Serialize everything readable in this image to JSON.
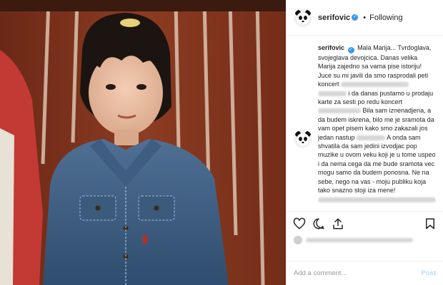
{
  "post": {
    "username": "serifovic",
    "follow_status": "Following",
    "separator": "•",
    "verified_glyph": "✓",
    "icons": {
      "avatar": "panda-avatar-icon",
      "verified": "verified-badge-icon",
      "like": "heart-icon",
      "comment": "comment-bubble-icon",
      "share": "share-upload-icon",
      "save": "bookmark-icon"
    },
    "photo_description_name": "child-in-denim-jacket-photo"
  },
  "caption": {
    "username": "serifovic",
    "parts": [
      "Mala Marija... Tvrdoglava, svojeglava devojcica. Danas velika Marija zajedno sa vama pise istoriju! Juce su mi javili da smo rasprodali peti koncert",
      "i da danas pustamo u prodaju karte za sesti po redu koncert",
      "Bila sam iznenadjena, a da budem iskrena, bilo me je sramota da vam opet pisem kako smo zakazali jos jedan nastup",
      "A onda sam shvatila da sam jedini izvodjac pop muzike u ovom veku koji je u tome uspeo i da nema cega da me bude sramota vec mogu samo da budem ponosna. Ne na sebe, nego na vas - moju publiku koja tako snazno stoji iza mene!"
    ]
  },
  "comment_box": {
    "placeholder": "Add a comment...",
    "post_label": "Post"
  },
  "colors": {
    "accent": "#3897f0",
    "post_disabled": "#b2dffc",
    "text": "#262626",
    "border": "#efefef"
  }
}
